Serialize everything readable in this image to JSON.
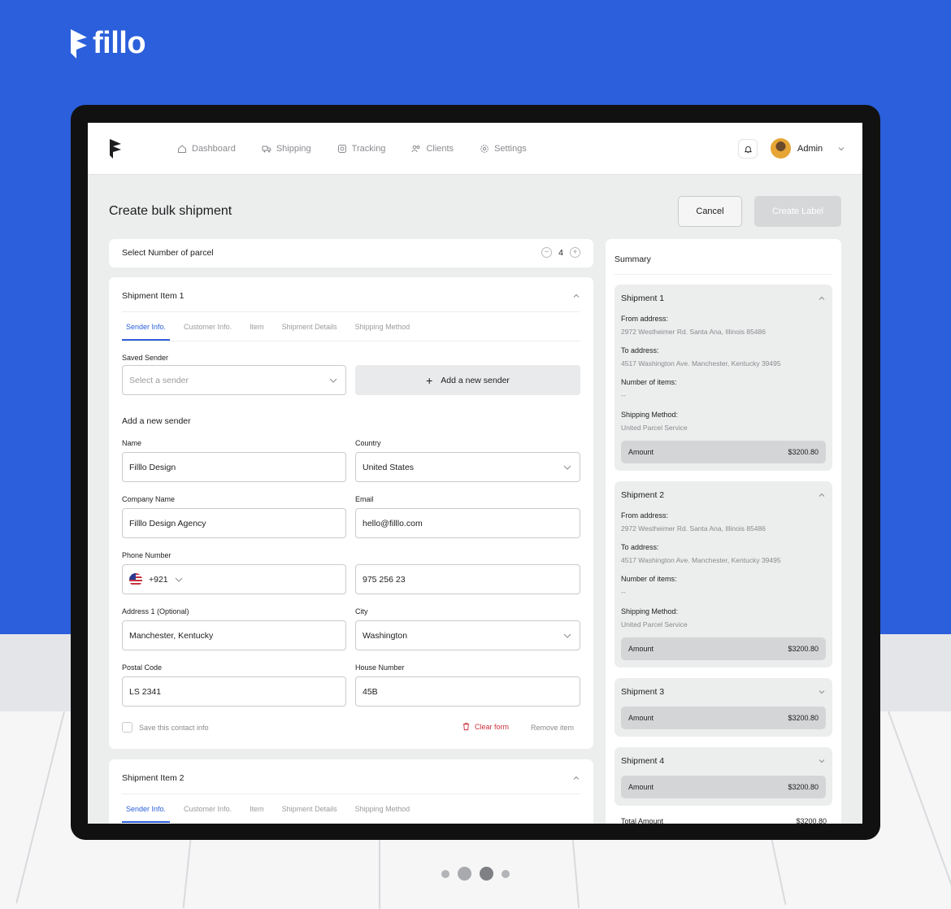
{
  "brand": {
    "name": "fillo"
  },
  "nav": {
    "items": [
      {
        "label": "Dashboard",
        "icon": "home-icon"
      },
      {
        "label": "Shipping",
        "icon": "truck-icon"
      },
      {
        "label": "Tracking",
        "icon": "tracking-icon"
      },
      {
        "label": "Clients",
        "icon": "clients-icon"
      },
      {
        "label": "Settings",
        "icon": "gear-icon"
      }
    ],
    "user": "Admin"
  },
  "page": {
    "title": "Create bulk shipment",
    "cancel": "Cancel",
    "create": "Create Label"
  },
  "parcel": {
    "label": "Select Number of parcel",
    "count": "4"
  },
  "item1": {
    "title": "Shipment Item 1",
    "tabs": [
      "Sender Info.",
      "Customer Info.",
      "Item",
      "Shipment Details",
      "Shipping Method"
    ],
    "saved_sender_label": "Saved Sender",
    "saved_sender_placeholder": "Select a sender",
    "add_sender": "Add a new sender",
    "new_sender_heading": "Add a new sender",
    "fields": {
      "name_label": "Name",
      "name": "Filllo Design",
      "country_label": "Country",
      "country": "United States",
      "company_label": "Company Name",
      "company": "Filllo Design Agency",
      "email_label": "Email",
      "email": "hello@filllo.com",
      "phone_label": "Phone Number",
      "phone_code": "+921",
      "phone": "975 256 23",
      "address_label": "Address 1 (Optional)",
      "address": "Manchester, Kentucky",
      "city_label": "City",
      "city": "Washington",
      "postal_label": "Postal Code",
      "postal": "LS 2341",
      "house_label": "House Number",
      "house": "45B"
    },
    "save_contact": "Save this contact info",
    "clear_form": "Clear form",
    "remove_item": "Remove item"
  },
  "item2": {
    "title": "Shipment Item 2",
    "tabs": [
      "Sender Info.",
      "Customer Info.",
      "Item",
      "Shipment Details",
      "Shipping Method"
    ]
  },
  "summary": {
    "title": "Summary",
    "from_label": "From address:",
    "to_label": "To address:",
    "items_label": "Number of items:",
    "method_label": "Shipping Method:",
    "amount_label": "Amount",
    "shipments": [
      {
        "name": "Shipment 1",
        "from": "2972 Westheimer Rd. Santa Ana, Illinois 85486",
        "to": "4517 Washington Ave. Manchester, Kentucky 39495",
        "items": "--",
        "method": "United Parcel Service",
        "amount": "$3200.80"
      },
      {
        "name": "Shipment 2",
        "from": "2972 Westheimer Rd. Santa Ana, Illinois 85486",
        "to": "4517 Washington Ave. Manchester, Kentucky 39495",
        "items": "--",
        "method": "United Parcel Service",
        "amount": "$3200.80"
      },
      {
        "name": "Shipment 3",
        "amount": "$3200.80"
      },
      {
        "name": "Shipment 4",
        "amount": "$3200.80"
      }
    ],
    "total_label": "Total Amount",
    "total": "$3200.80"
  },
  "colors": {
    "accent": "#2b5fdb",
    "danger": "#c9303b"
  }
}
